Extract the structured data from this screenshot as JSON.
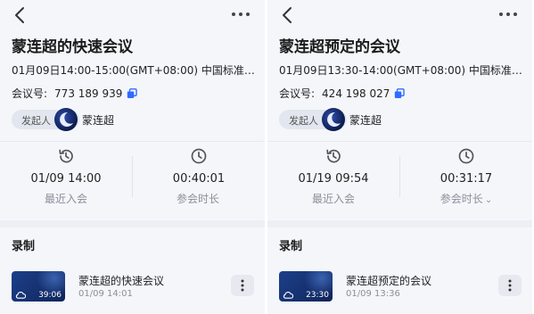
{
  "left": {
    "title": "蒙连超的快速会议",
    "time": "01月09日14:00-15:00(GMT+08:00) 中国标准时间...",
    "meeting_id_label": "会议号:",
    "meeting_id": "773 189 939",
    "host_label": "发起人",
    "host_name": "蒙连超",
    "last_join_value": "01/09 14:00",
    "last_join_label": "最近入会",
    "duration_value": "00:40:01",
    "duration_label": "参会时长",
    "duration_chevron": "",
    "section_title": "录制",
    "recording": {
      "name": "蒙连超的快速会议",
      "time": "01/09 14:01",
      "duration": "39:06"
    }
  },
  "right": {
    "title": "蒙连超预定的会议",
    "time": "01月09日13:30-14:00(GMT+08:00) 中国标准时间...",
    "meeting_id_label": "会议号:",
    "meeting_id": "424 198 027",
    "host_label": "发起人",
    "host_name": "蒙连超",
    "last_join_value": "01/19 09:54",
    "last_join_label": "最近入会",
    "duration_value": "00:31:17",
    "duration_label": "参会时长",
    "duration_chevron": "⌄",
    "section_title": "录制",
    "recording": {
      "name": "蒙连超预定的会议",
      "time": "01/09 13:36",
      "duration": "23:30"
    }
  },
  "icons": {
    "back": "chevron-left-icon",
    "more": "more-horizontal-icon",
    "copy": "copy-icon",
    "history": "history-clock-icon",
    "clock": "clock-icon",
    "cloud": "cloud-icon",
    "rec_more": "more-vertical-icon"
  },
  "colors": {
    "accent": "#2f6bff",
    "background": "#f4f6fa",
    "muted_text": "#8a8f98",
    "thumbnail": "#163272"
  }
}
